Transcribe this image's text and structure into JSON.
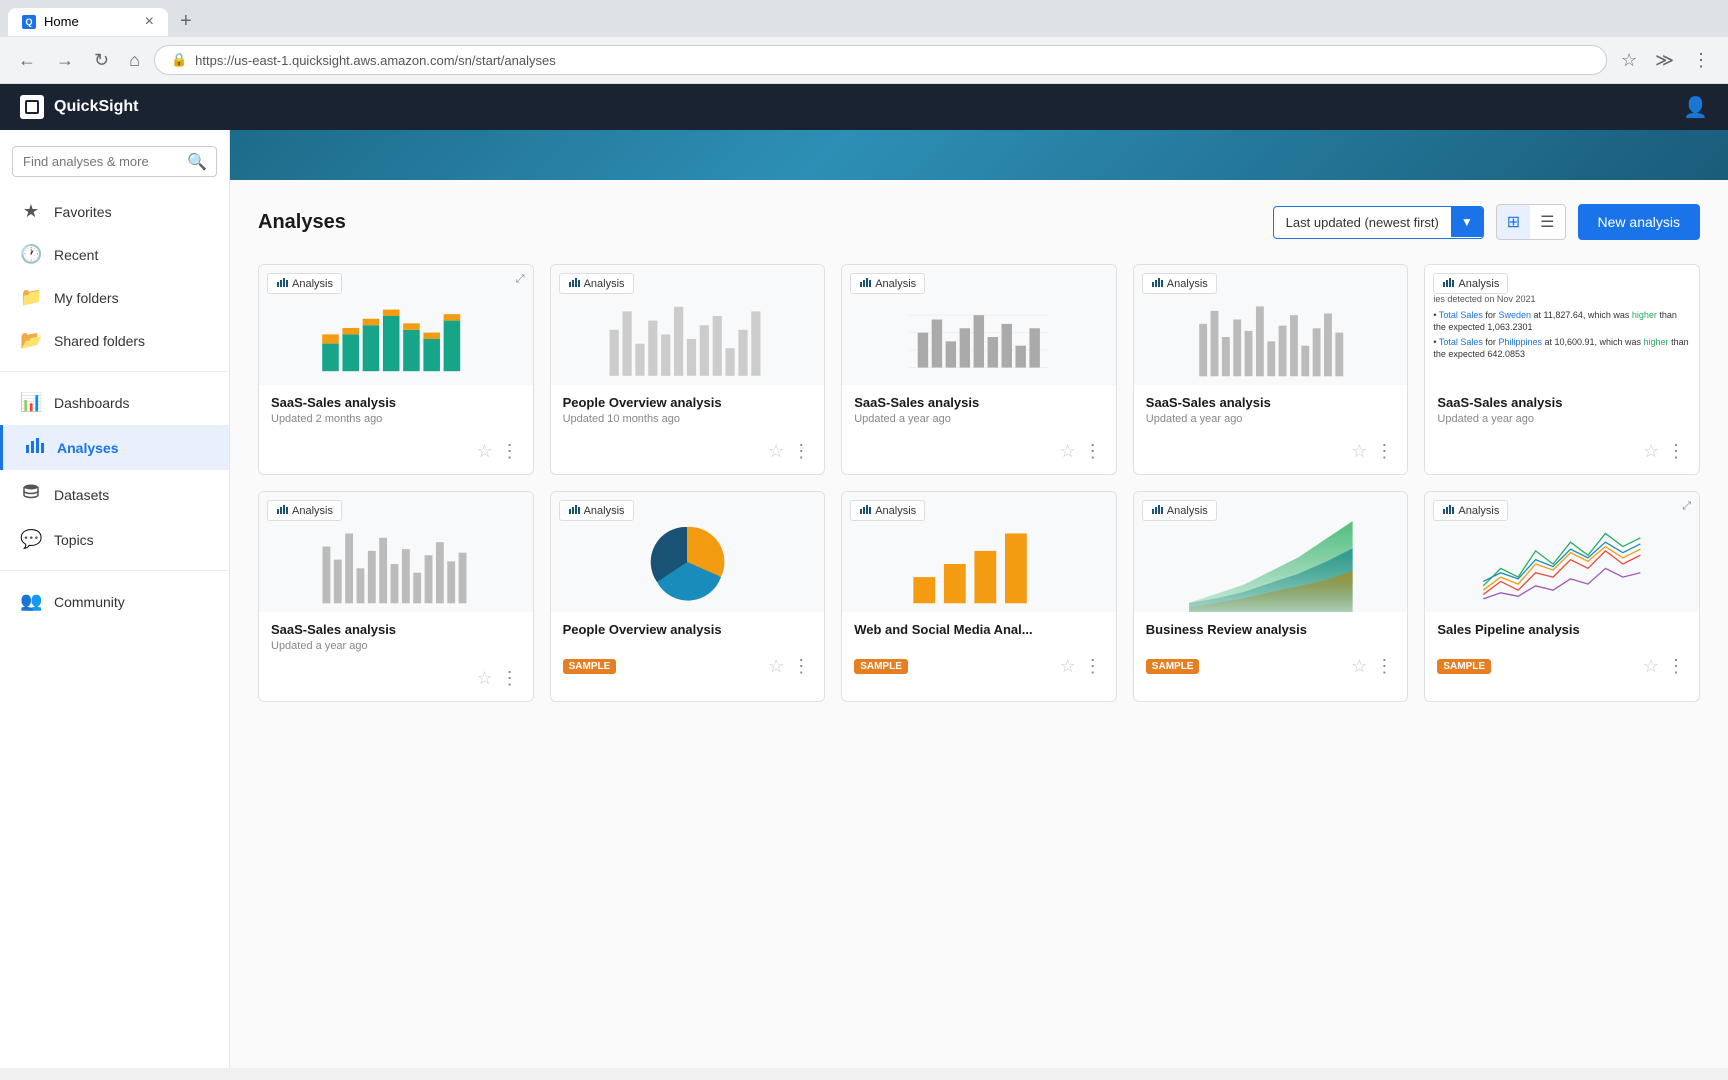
{
  "browser": {
    "tab_title": "Home",
    "favicon_text": "Q",
    "url": "https://us-east-1.quicksight.aws.amazon.com/sn/start/analyses"
  },
  "app": {
    "brand": "QuickSight",
    "page_title": "Analyses",
    "sort_label": "Last updated (newest first)",
    "new_analysis_label": "New analysis"
  },
  "sidebar": {
    "search_placeholder": "Find analyses & more",
    "items": [
      {
        "id": "favorites",
        "label": "Favorites",
        "icon": "★"
      },
      {
        "id": "recent",
        "label": "Recent",
        "icon": "🕐"
      },
      {
        "id": "my-folders",
        "label": "My folders",
        "icon": "📁"
      },
      {
        "id": "shared-folders",
        "label": "Shared folders",
        "icon": "📂"
      },
      {
        "id": "dashboards",
        "label": "Dashboards",
        "icon": "📊"
      },
      {
        "id": "analyses",
        "label": "Analyses",
        "icon": "📈",
        "active": true
      },
      {
        "id": "datasets",
        "label": "Datasets",
        "icon": "🗄"
      },
      {
        "id": "topics",
        "label": "Topics",
        "icon": "💬"
      },
      {
        "id": "community",
        "label": "Community",
        "icon": "👥"
      }
    ]
  },
  "analyses": {
    "row1": [
      {
        "id": "saas-sales-1",
        "title": "SaaS-Sales analysis",
        "subtitle": "Updated 2 months ago",
        "badge": "Analysis",
        "sample": false,
        "chart_type": "bar_color"
      },
      {
        "id": "people-overview-1",
        "title": "People Overview analysis",
        "subtitle": "Updated 10 months ago",
        "badge": "Analysis",
        "sample": false,
        "chart_type": "bar_gray"
      },
      {
        "id": "saas-sales-2",
        "title": "SaaS-Sales analysis",
        "subtitle": "Updated a year ago",
        "badge": "Analysis",
        "sample": false,
        "chart_type": "bar_light"
      },
      {
        "id": "saas-sales-3",
        "title": "SaaS-Sales analysis",
        "subtitle": "Updated a year ago",
        "badge": "Analysis",
        "sample": false,
        "chart_type": "bar_gray2"
      },
      {
        "id": "saas-sales-4",
        "title": "SaaS-Sales analysis",
        "subtitle": "Updated a year ago",
        "badge": "Analysis",
        "sample": false,
        "chart_type": "insight"
      }
    ],
    "row2": [
      {
        "id": "saas-sales-5",
        "title": "SaaS-Sales analysis",
        "subtitle": "Updated a year ago",
        "badge": "Analysis",
        "sample": false,
        "chart_type": "bar_gray3"
      },
      {
        "id": "people-overview-2",
        "title": "People Overview analysis",
        "subtitle": "",
        "badge": "Analysis",
        "sample": true,
        "chart_type": "pie"
      },
      {
        "id": "web-social",
        "title": "Web and Social Media Anal...",
        "subtitle": "",
        "badge": "Analysis",
        "sample": true,
        "chart_type": "bar_orange"
      },
      {
        "id": "business-review",
        "title": "Business Review analysis",
        "subtitle": "",
        "badge": "Analysis",
        "sample": true,
        "chart_type": "area_green"
      },
      {
        "id": "sales-pipeline",
        "title": "Sales Pipeline analysis",
        "subtitle": "",
        "badge": "Analysis",
        "sample": true,
        "chart_type": "line_multi"
      }
    ]
  }
}
